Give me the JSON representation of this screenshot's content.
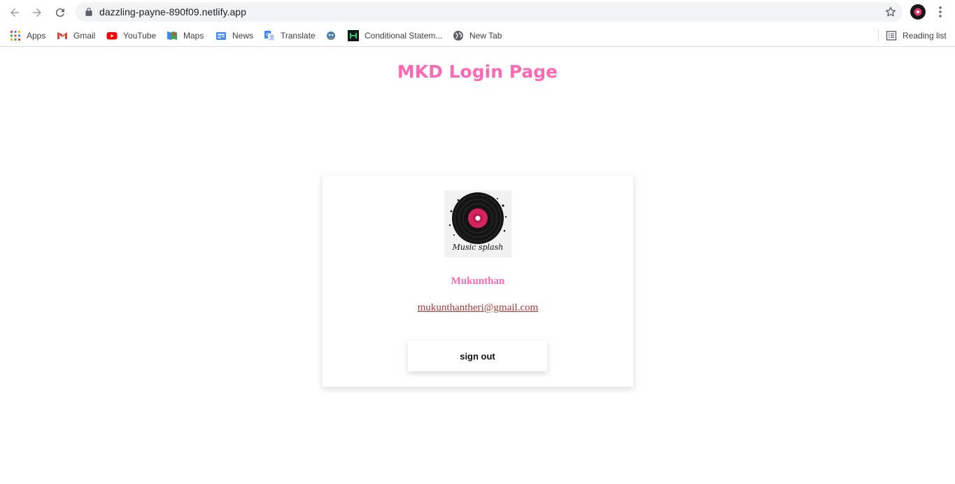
{
  "browser": {
    "url": "dazzling-payne-890f09.netlify.app",
    "bookmarks": [
      {
        "label": "Apps",
        "icon": "apps-grid-icon"
      },
      {
        "label": "Gmail",
        "icon": "gmail-icon"
      },
      {
        "label": "YouTube",
        "icon": "youtube-icon"
      },
      {
        "label": "Maps",
        "icon": "maps-icon"
      },
      {
        "label": "News",
        "icon": "news-icon"
      },
      {
        "label": "Translate",
        "icon": "translate-icon"
      },
      {
        "label": "",
        "icon": "bird-icon"
      },
      {
        "label": "Conditional Statem...",
        "icon": "hackerrank-icon"
      },
      {
        "label": "New Tab",
        "icon": "globe-icon"
      }
    ],
    "reading_list": "Reading list"
  },
  "page": {
    "title": "MKD Login Page",
    "accent_color": "#ff69b4",
    "profile": {
      "logo_text": "Music splash",
      "name": "Mukunthan",
      "email": "mukunthantheri@gmail.com",
      "sign_out_label": "sign out"
    }
  }
}
